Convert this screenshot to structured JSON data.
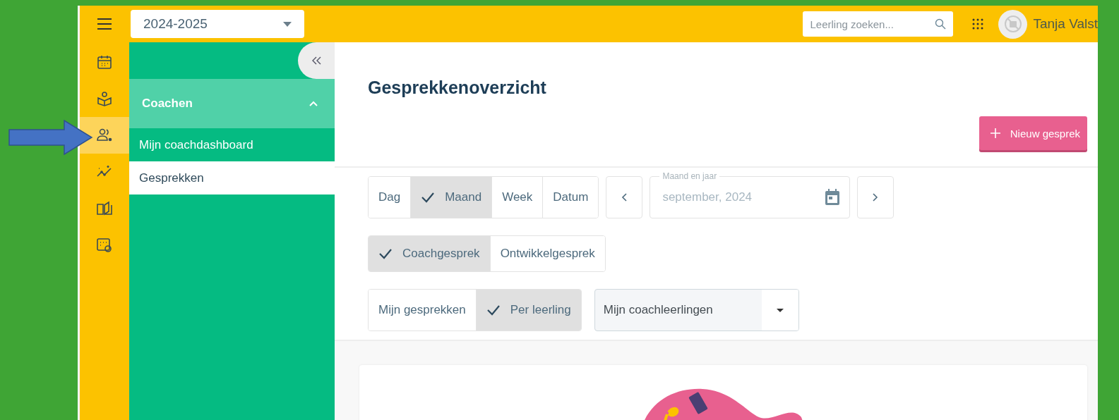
{
  "year_select": {
    "value": "2024-2025"
  },
  "search": {
    "placeholder": "Leerling zoeken..."
  },
  "user": {
    "name": "Tanja Valst"
  },
  "rail": [
    {
      "kind": "calendar",
      "selected": false
    },
    {
      "kind": "reader",
      "selected": false
    },
    {
      "kind": "people",
      "selected": true
    },
    {
      "kind": "trend",
      "selected": false
    },
    {
      "kind": "book",
      "selected": false
    },
    {
      "kind": "card",
      "selected": false
    }
  ],
  "sidebar": {
    "section": {
      "title": "Coachen",
      "expanded": true
    },
    "items": [
      {
        "label": "Mijn coachdashboard",
        "selected": false
      },
      {
        "label": "Gesprekken",
        "selected": true
      }
    ]
  },
  "page_title": "Gesprekkenoverzicht",
  "new_button": {
    "label": "Nieuw gesprek"
  },
  "period_tabs": [
    {
      "label": "Dag",
      "selected": false
    },
    {
      "label": "Maand",
      "selected": true
    },
    {
      "label": "Week",
      "selected": false
    },
    {
      "label": "Datum",
      "selected": false
    }
  ],
  "date_field": {
    "label": "Maand en jaar",
    "value": "september, 2024"
  },
  "type_tabs": [
    {
      "label": "Coachgesprek",
      "selected": true
    },
    {
      "label": "Ontwikkelgesprek",
      "selected": false
    }
  ],
  "scope_tabs": [
    {
      "label": "Mijn gesprekken",
      "selected": false
    },
    {
      "label": "Per leerling",
      "selected": true
    }
  ],
  "student_select": {
    "value": "Mijn coachleerlingen"
  }
}
